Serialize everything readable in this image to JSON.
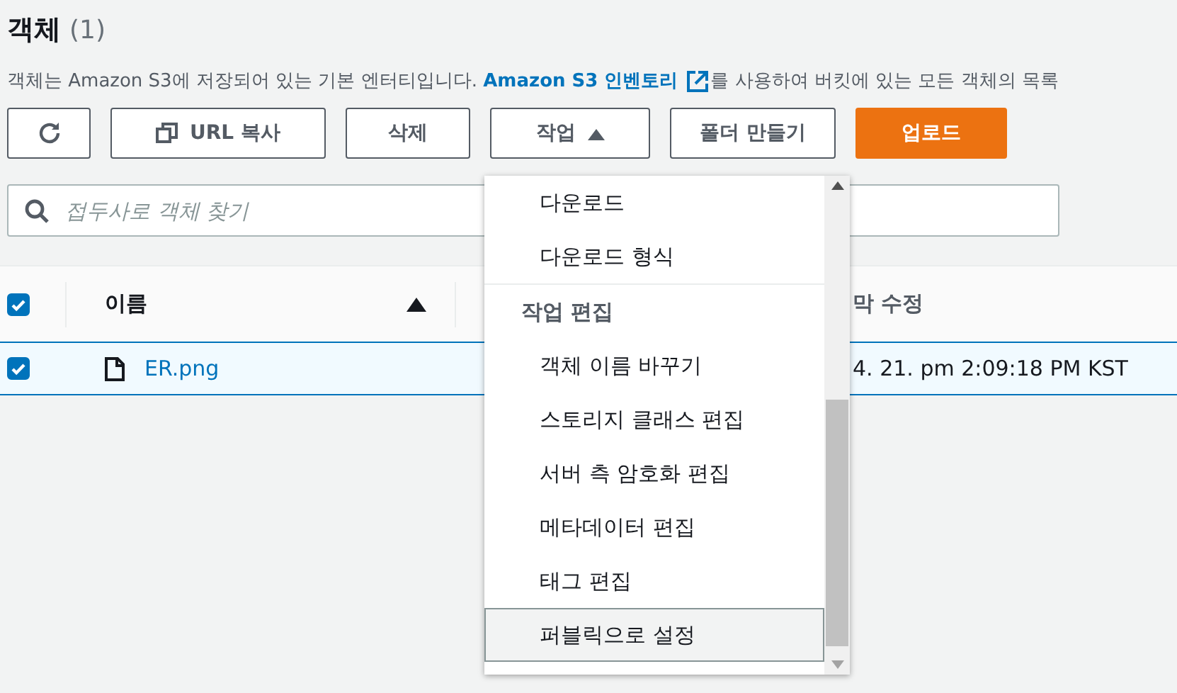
{
  "header": {
    "title": "객체",
    "count": "(1)"
  },
  "description": {
    "before": "객체는 Amazon S3에 저장되어 있는 기본 엔터티입니다. ",
    "link": "Amazon S3 인벤토리",
    "after": "를 사용하여 버킷에 있는 모든 객체의 목록"
  },
  "toolbar": [
    {
      "kind": "refresh"
    },
    {
      "kind": "copy",
      "label": "URL 복사"
    },
    {
      "kind": "plain",
      "label": "삭제"
    },
    {
      "kind": "menu",
      "label": "작업",
      "expanded": true
    },
    {
      "kind": "plain",
      "label": "폴더 만들기"
    },
    {
      "kind": "primary",
      "label": "업로드"
    }
  ],
  "search": {
    "placeholder": "접두사로 객체 찾기"
  },
  "table": {
    "select_all_checked": true,
    "columns": [
      {
        "label": "이름"
      },
      {
        "label": "막 수정"
      }
    ],
    "rows": [
      {
        "name": "ER.png",
        "checked": true,
        "selected": true,
        "modified": "4. 21. pm 2:09:18 PM KST"
      }
    ]
  },
  "menu": {
    "items": [
      {
        "kind": "item",
        "label": "다운로드",
        "hovered": false
      },
      {
        "kind": "item",
        "label": "다운로드 형식",
        "hovered": false
      },
      {
        "kind": "group",
        "label": "작업 편집"
      },
      {
        "kind": "item",
        "label": "객체 이름 바꾸기",
        "hovered": false
      },
      {
        "kind": "item",
        "label": "스토리지 클래스 편집",
        "hovered": false
      },
      {
        "kind": "item",
        "label": "서버 측 암호화 편집",
        "hovered": false
      },
      {
        "kind": "item",
        "label": "메타데이터 편집",
        "hovered": false
      },
      {
        "kind": "item",
        "label": "태그 편집",
        "hovered": false
      },
      {
        "kind": "item",
        "label": "퍼블릭으로 설정",
        "hovered": true
      }
    ]
  }
}
